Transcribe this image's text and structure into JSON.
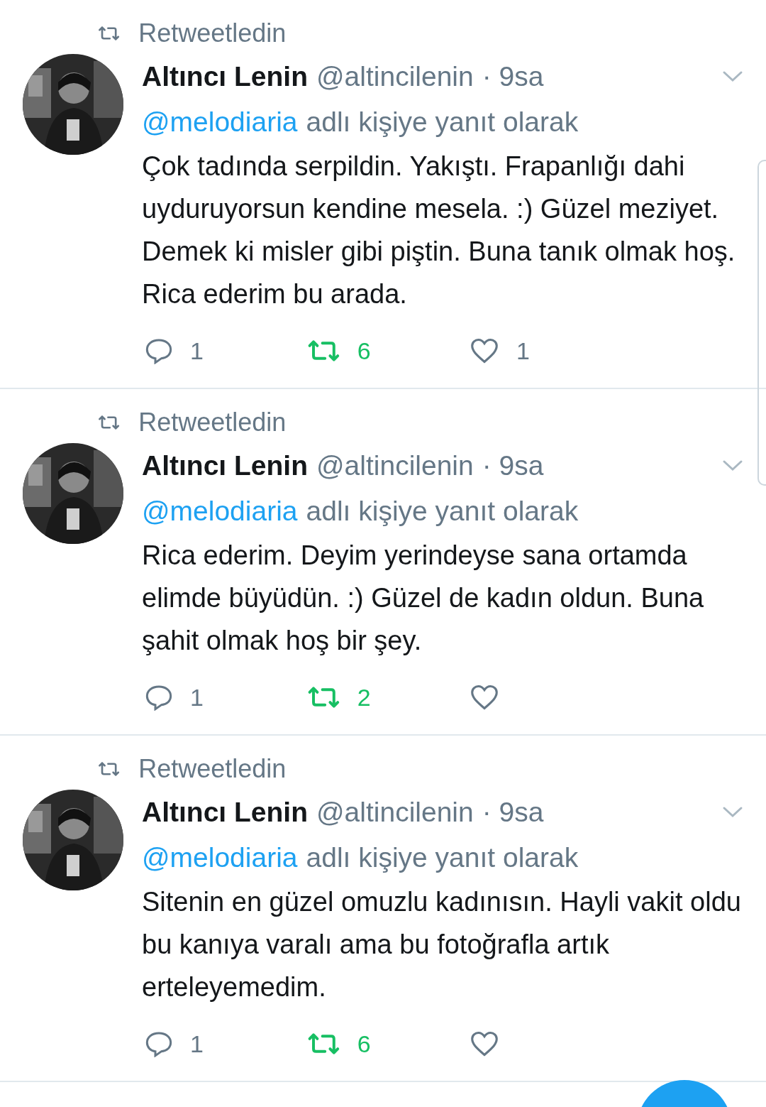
{
  "tweets": [
    {
      "retweet_label": "Retweetledin",
      "name": "Altıncı Lenin",
      "handle": "@altincilenin",
      "time": "· 9sa",
      "reply_to": "@melodiaria",
      "reply_suffix": "adlı kişiye yanıt olarak",
      "text": "Çok tadında serpildin. Yakıştı. Frapanlığı dahi uyduruyorsun kendine mesela. :) Güzel meziyet. Demek ki misler gibi piştin. Buna tanık olmak hoş. Rica ederim bu arada.",
      "replies": "1",
      "retweets": "6",
      "retweeted": true,
      "likes": "1",
      "liked": false
    },
    {
      "retweet_label": "Retweetledin",
      "name": "Altıncı Lenin",
      "handle": "@altincilenin",
      "time": "· 9sa",
      "reply_to": "@melodiaria",
      "reply_suffix": "adlı kişiye yanıt olarak",
      "text": "Rica ederim. Deyim yerindeyse sana ortamda elimde büyüdün. :) Güzel de kadın oldun. Buna şahit olmak hoş bir şey.",
      "replies": "1",
      "retweets": "2",
      "retweeted": true,
      "liked": false
    },
    {
      "retweet_label": "Retweetledin",
      "name": "Altıncı Lenin",
      "handle": "@altincilenin",
      "time": "· 9sa",
      "reply_to": "@melodiaria",
      "reply_suffix": "adlı kişiye yanıt olarak",
      "text": "Sitenin en güzel omuzlu kadınısın. Hayli vakit oldu bu kanıya varalı ama bu fotoğrafla artık erteleyemedim.",
      "replies": "1",
      "retweets": "6",
      "retweeted": true,
      "liked": false
    }
  ]
}
